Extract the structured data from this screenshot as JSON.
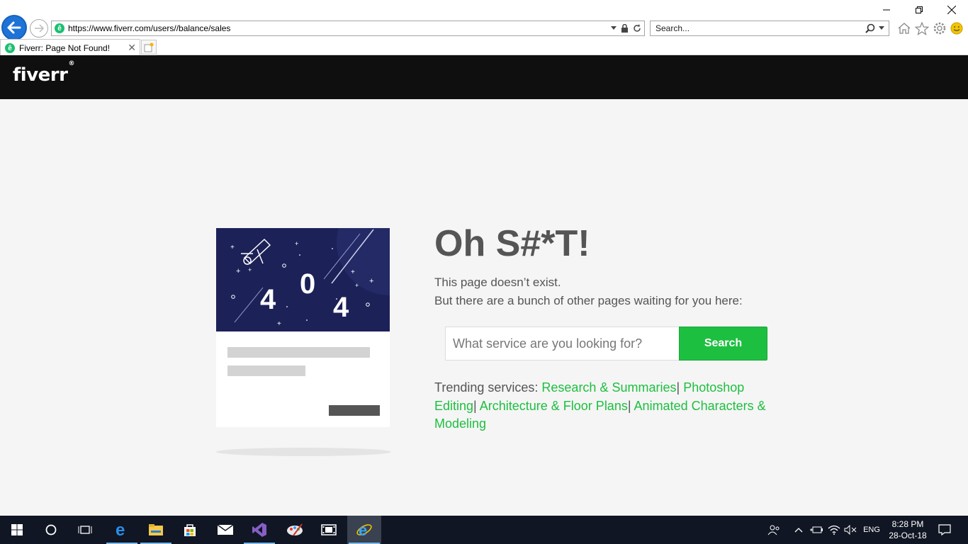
{
  "browser": {
    "url": "https://www.fiverr.com/users//balance/sales",
    "search_placeholder": "Search...",
    "tab_title": "Fiverr: Page Not Found!",
    "site_icon_letter": "ê"
  },
  "site": {
    "logo": "fiverr",
    "logo_mark": "®"
  },
  "error_card": {
    "digit1": "4",
    "digit2": "0",
    "digit3": "4"
  },
  "main": {
    "heading": "Oh S#*T!",
    "line1": "This page doesn’t exist.",
    "line2": "But there are a bunch of other pages waiting for you here:",
    "search_placeholder": "What service are you looking for?",
    "search_button": "Search",
    "trending_label": "Trending services:",
    "trending": [
      "Research & Summaries",
      "Photoshop Editing",
      "Architecture & Floor Plans",
      "Animated Characters & Modeling"
    ],
    "separator": "|"
  },
  "taskbar": {
    "language": "ENG",
    "time": "8:28 PM",
    "date": "28-Oct-18"
  },
  "colors": {
    "brand_green": "#1dbf40",
    "header_black": "#0f0f0f",
    "card_navy": "#1c2158",
    "taskbar": "#101623",
    "ie_back_blue": "#1e73d6"
  }
}
